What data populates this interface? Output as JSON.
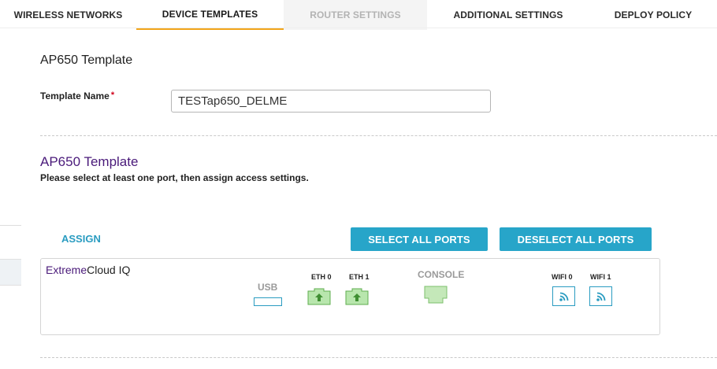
{
  "tabs": [
    {
      "label": "WIRELESS NETWORKS",
      "state": "normal"
    },
    {
      "label": "DEVICE TEMPLATES",
      "state": "active"
    },
    {
      "label": "ROUTER SETTINGS",
      "state": "disabled"
    },
    {
      "label": "ADDITIONAL SETTINGS",
      "state": "normal"
    },
    {
      "label": "DEPLOY POLICY",
      "state": "normal"
    }
  ],
  "page": {
    "section_title": "AP650 Template",
    "template_name_label": "Template Name",
    "required_marker": "*",
    "template_name_value": "TESTap650_DELME"
  },
  "template": {
    "heading": "AP650 Template",
    "instruction": "Please select at least one port, then assign access settings."
  },
  "actions": {
    "assign": "ASSIGN",
    "select_all": "SELECT ALL PORTS",
    "deselect_all": "DESELECT ALL PORTS"
  },
  "device": {
    "brand_part1": "Extreme",
    "brand_part2": "Cloud IQ",
    "ports": {
      "usb": "USB",
      "eth0": "ETH 0",
      "eth1": "ETH 1",
      "console": "CONSOLE",
      "wifi0": "WIFI 0",
      "wifi1": "WIFI 1"
    }
  },
  "colors": {
    "accent_tab": "#f2a51a",
    "button_bg": "#27a5c9",
    "link": "#2a9cc1",
    "heading_purple": "#4a1a7a",
    "port_green": "#8ccf7e"
  },
  "icons": {
    "eth": "ethernet-port-up-arrow-icon",
    "console": "console-port-icon",
    "wifi": "wifi-signal-icon"
  }
}
